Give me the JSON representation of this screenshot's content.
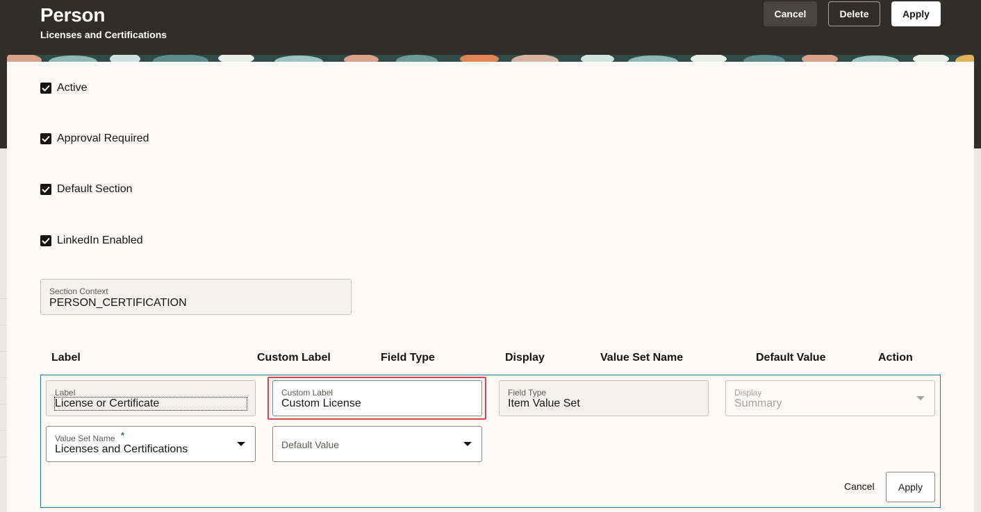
{
  "header": {
    "title": "Person",
    "subtitle": "Licenses and Certifications",
    "cancel_label": "Cancel",
    "delete_label": "Delete",
    "apply_label": "Apply"
  },
  "checkboxes": [
    {
      "label": "Active",
      "checked": true
    },
    {
      "label": "Approval Required",
      "checked": true
    },
    {
      "label": "Default Section",
      "checked": true
    },
    {
      "label": "LinkedIn Enabled",
      "checked": true
    }
  ],
  "section_context": {
    "label": "Section Context",
    "value": "PERSON_CERTIFICATION"
  },
  "table": {
    "columns": [
      "Label",
      "Custom Label",
      "Field Type",
      "Display",
      "Value Set Name",
      "Default Value",
      "Action"
    ]
  },
  "edit_row": {
    "label_field": {
      "label": "Label",
      "value": "License or Certificate"
    },
    "custom_label_field": {
      "label": "Custom Label",
      "value": "Custom License"
    },
    "field_type_field": {
      "label": "Field Type",
      "value": "Item Value Set"
    },
    "display_field": {
      "label": "Display",
      "value": "Summary"
    },
    "value_set_field": {
      "label": "Value Set Name",
      "required_mark": "*",
      "value": "Licenses and Certifications"
    },
    "default_value_field": {
      "placeholder": "Default Value"
    },
    "cancel_label": "Cancel",
    "apply_label": "Apply"
  },
  "colors": {
    "header_bg": "#312d2a",
    "panel_border": "#2a6f93",
    "highlight": "#d9454a"
  }
}
